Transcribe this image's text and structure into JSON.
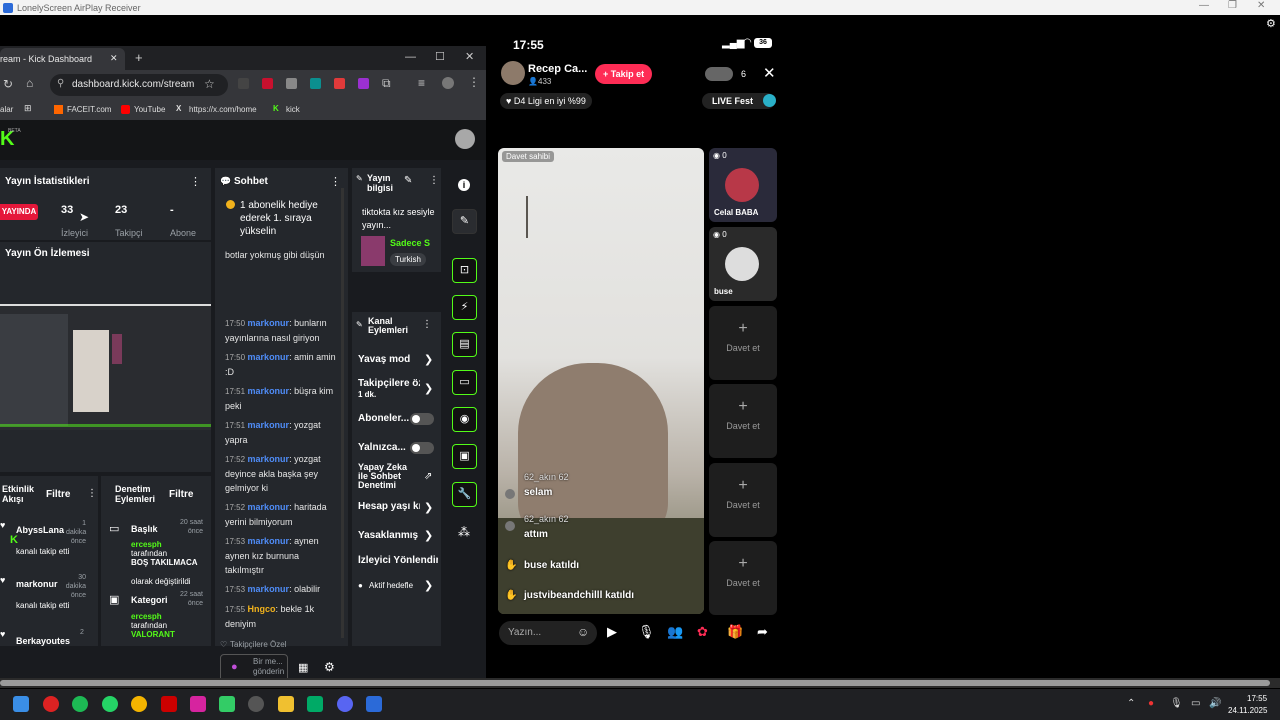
{
  "window": {
    "title": "LonelyScreen AirPlay Receiver"
  },
  "browser": {
    "tab_title": "ream - Kick Dashboard",
    "url": "dashboard.kick.com/stream",
    "bookmarks": [
      "alar",
      "FACEIT.com",
      "YouTube",
      "https://x.com/home",
      "kick"
    ]
  },
  "dashboard": {
    "beta": "BETA",
    "stats": {
      "title": "Yayın İstatistikleri",
      "live_badge": "YAYINDA",
      "viewers": "33",
      "viewers_label": "İzleyici",
      "followers": "23",
      "followers_label": "Takipçi",
      "subs": "-",
      "subs_label": "Abone"
    },
    "preview": {
      "title": "Yayın Ön İzlemesi"
    },
    "chat": {
      "title": "Sohbet",
      "pinned": "1 abonelik hediye ederek 1. sıraya yükselin",
      "first": "botlar yokmuş gibi düşün",
      "messages": [
        {
          "time": "17:50",
          "user": "markonur",
          "text": ": bunların yayınlarına nasıl giriyon"
        },
        {
          "time": "17:50",
          "user": "markonur",
          "text": ": amin amin :D"
        },
        {
          "time": "17:51",
          "user": "markonur",
          "text": ": büşra kim peki"
        },
        {
          "time": "17:51",
          "user": "markonur",
          "text": ": yozgat yapra"
        },
        {
          "time": "17:52",
          "user": "markonur",
          "text": ": yozgat deyince akla başka şey gelmiyor ki"
        },
        {
          "time": "17:52",
          "user": "markonur",
          "text": ": haritada yerini bilmiyorum"
        },
        {
          "time": "17:53",
          "user": "markonur",
          "text": ": aynen aynen kız burnuna takılmıştır"
        },
        {
          "time": "17:53",
          "user": "markonur",
          "text": ": olabilir"
        },
        {
          "time": "17:55",
          "user": "Hngco",
          "text": ": bekle 1k deniyim"
        }
      ],
      "followers_only": "Takipçilere Özel",
      "input_placeholder": "Bir me... gönderin"
    },
    "stream_info": {
      "title": "Yayın bilgisi",
      "stream_title": "tiktokta kız sesiyle yayın...",
      "category": "Sadece S",
      "language": "Turkish"
    },
    "channel_actions": {
      "title": "Kanal Eylemleri",
      "items": [
        "Yavaş mod",
        "Takipçilere öz",
        "1 dk.",
        "Aboneler...",
        "Yalnızca...",
        "Yapay Zeka ile Sohbet Denetimi",
        "Hesap yaşı kı",
        "Yasaklanmış İ",
        "İzleyici Yönlendir",
        "Aktif hedefle"
      ]
    },
    "activity": {
      "title": "Etkinlik Akışı",
      "filter": "Filtre",
      "items": [
        {
          "user": "AbyssLana",
          "time": "1 dakika önce",
          "text": "kanalı takip etti"
        },
        {
          "user": "markonur",
          "time": "30 dakika önce",
          "text": "kanalı takip etti"
        },
        {
          "user": "Berkayoutes",
          "time": "2"
        }
      ]
    },
    "moderation": {
      "title": "Denetim Eylemleri",
      "filter": "Filtre",
      "items": [
        {
          "label": "Başlık",
          "time": "20 saat önce",
          "by": "ercesph",
          "text1": "tarafından",
          "value": "BOŞ TAKILMACA",
          "text2": "olarak değiştirildi"
        },
        {
          "label": "Kategori",
          "time": "22 saat önce",
          "by": "ercesph",
          "text1": "tarafından",
          "value": "VALORANT"
        }
      ]
    }
  },
  "phone": {
    "time": "17:55",
    "battery": "36",
    "host": {
      "name": "Recep Ca...",
      "followers": "433",
      "follow_btn": "Takip et"
    },
    "viewers": "6",
    "rank": "D4 Ligi en iyi %99",
    "live_fest": "LIVE Fest",
    "host_label": "Davet sahibi",
    "guests": [
      {
        "name": "Celal BABA",
        "count": "0"
      },
      {
        "name": "buse",
        "count": "0"
      }
    ],
    "invite": "Davet et",
    "comments": [
      {
        "user": "62_akın 62",
        "text": "selam"
      },
      {
        "user": "62_akın 62",
        "text": "attım"
      },
      {
        "user": "",
        "text": "buse katıldı"
      },
      {
        "user": "",
        "text": "justvibeandchilll katıldı"
      }
    ],
    "input_placeholder": "Yazın..."
  },
  "taskbar": {
    "time": "17:55",
    "date": "24.11.2025"
  }
}
